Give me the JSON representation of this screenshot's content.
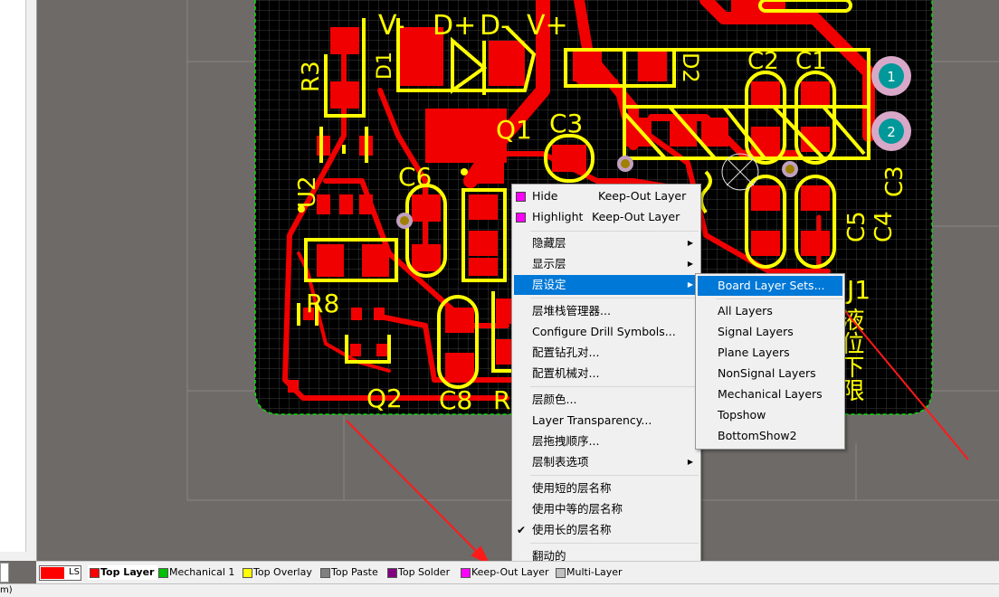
{
  "pcb": {
    "silk": {
      "v_minus": "V-",
      "d_plus": "D+",
      "d_minus": "D-",
      "v_plus": "V+",
      "r3": "R3",
      "d1": "D1",
      "q1": "Q1",
      "c3a": "C3",
      "d2": "D2",
      "c2": "C2",
      "c1": "C1",
      "u2": "U2",
      "c6": "C6",
      "c5": "C5",
      "c4": "C4",
      "c3b": "C3",
      "r8": "R8",
      "q2": "Q2",
      "c8": "C8",
      "r_partial": "R",
      "j1": "J1",
      "chinese_label": "液位下限"
    },
    "pad_labels": [
      "1",
      "2"
    ]
  },
  "context_menu": {
    "items": [
      {
        "label": "Hide",
        "shortcut": "Keep-Out Layer",
        "swatch": "#ff00ff"
      },
      {
        "label": "Highlight",
        "shortcut": "Keep-Out Layer",
        "swatch": "#ff00ff"
      },
      {
        "label": "隐藏层"
      },
      {
        "label": "显示层"
      },
      {
        "label": "层设定"
      },
      {
        "label": "层堆栈管理器..."
      },
      {
        "label": "Configure Drill Symbols..."
      },
      {
        "label": "配置钻孔对..."
      },
      {
        "label": "配置机械对..."
      },
      {
        "label": "层颜色..."
      },
      {
        "label": "Layer Transparency..."
      },
      {
        "label": "层拖拽顺序..."
      },
      {
        "label": "层制表选项"
      },
      {
        "label": "使用短的层名称"
      },
      {
        "label": "使用中等的层名称"
      },
      {
        "label": "使用长的层名称",
        "checked": "✔"
      },
      {
        "label": "翻动的"
      }
    ]
  },
  "submenu": {
    "items": [
      {
        "label": "Board Layer Sets..."
      },
      {
        "label": "All Layers"
      },
      {
        "label": "Signal Layers"
      },
      {
        "label": "Plane Layers"
      },
      {
        "label": "NonSignal Layers"
      },
      {
        "label": "Mechanical Layers"
      },
      {
        "label": "Topshow"
      },
      {
        "label": "BottomShow2"
      }
    ]
  },
  "layer_bar": {
    "ls_label": "LS",
    "tabs": [
      {
        "label": "Top Layer",
        "color": "#ff0000"
      },
      {
        "label": "Mechanical 1",
        "color": "#00c000"
      },
      {
        "label": "Top Overlay",
        "color": "#ffff00"
      },
      {
        "label": "Top Paste",
        "color": "#808080"
      },
      {
        "label": "Top Solder",
        "color": "#800080"
      },
      {
        "label": "Keep-Out Layer",
        "color": "#ff00ff"
      },
      {
        "label": "Multi-Layer",
        "color": "#c0c0c0"
      }
    ]
  },
  "status": {
    "left_text": "m)"
  }
}
